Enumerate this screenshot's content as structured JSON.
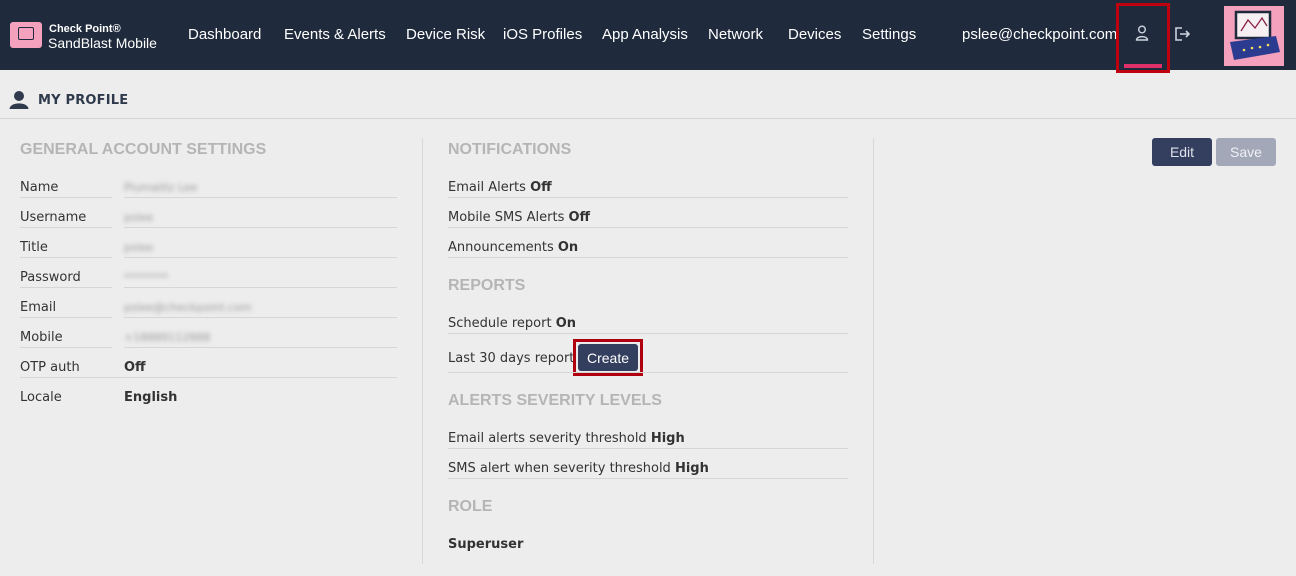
{
  "brand": {
    "top": "Check Point®",
    "bottom": "SandBlast Mobile"
  },
  "nav": [
    {
      "label": "Dashboard"
    },
    {
      "label": "Events & Alerts"
    },
    {
      "label": "Device Risk"
    },
    {
      "label": "iOS Profiles"
    },
    {
      "label": "App Analysis"
    },
    {
      "label": "Network"
    },
    {
      "label": "Devices"
    },
    {
      "label": "Settings"
    }
  ],
  "user_email": "pslee@checkpoint.com",
  "page_title": "MY PROFILE",
  "general": {
    "heading": "GENERAL ACCOUNT SETTINGS",
    "rows": [
      {
        "label": "Name",
        "value": "Plumalitz Lee"
      },
      {
        "label": "Username",
        "value": "pslee"
      },
      {
        "label": "Title",
        "value": "pslee"
      },
      {
        "label": "Password",
        "value": "********"
      },
      {
        "label": "Email",
        "value": "pslee@checkpoint.com"
      },
      {
        "label": "Mobile",
        "value": "+18889112888"
      },
      {
        "label": "OTP auth",
        "value": "Off"
      },
      {
        "label": "Locale",
        "value": "English"
      }
    ]
  },
  "notifications": {
    "heading": "NOTIFICATIONS",
    "rows": [
      {
        "label": "Email Alerts",
        "value": "Off"
      },
      {
        "label": "Mobile SMS Alerts",
        "value": "Off"
      },
      {
        "label": "Announcements",
        "value": "On"
      }
    ]
  },
  "reports": {
    "heading": "REPORTS",
    "schedule_label": "Schedule report",
    "schedule_value": "On",
    "last30_label": "Last 30 days report",
    "create_label": "Create"
  },
  "severity": {
    "heading": "ALERTS SEVERITY LEVELS",
    "rows": [
      {
        "label": "Email alerts severity threshold",
        "value": "High"
      },
      {
        "label": "SMS alert when severity threshold",
        "value": "High"
      }
    ]
  },
  "role": {
    "heading": "ROLE",
    "value": "Superuser"
  },
  "actions": {
    "edit": "Edit",
    "save": "Save"
  },
  "colors": {
    "topbar": "#1f2a3c",
    "button": "#343e5f",
    "highlight": "#c0000f",
    "accent_pink": "#f3a1bd"
  }
}
